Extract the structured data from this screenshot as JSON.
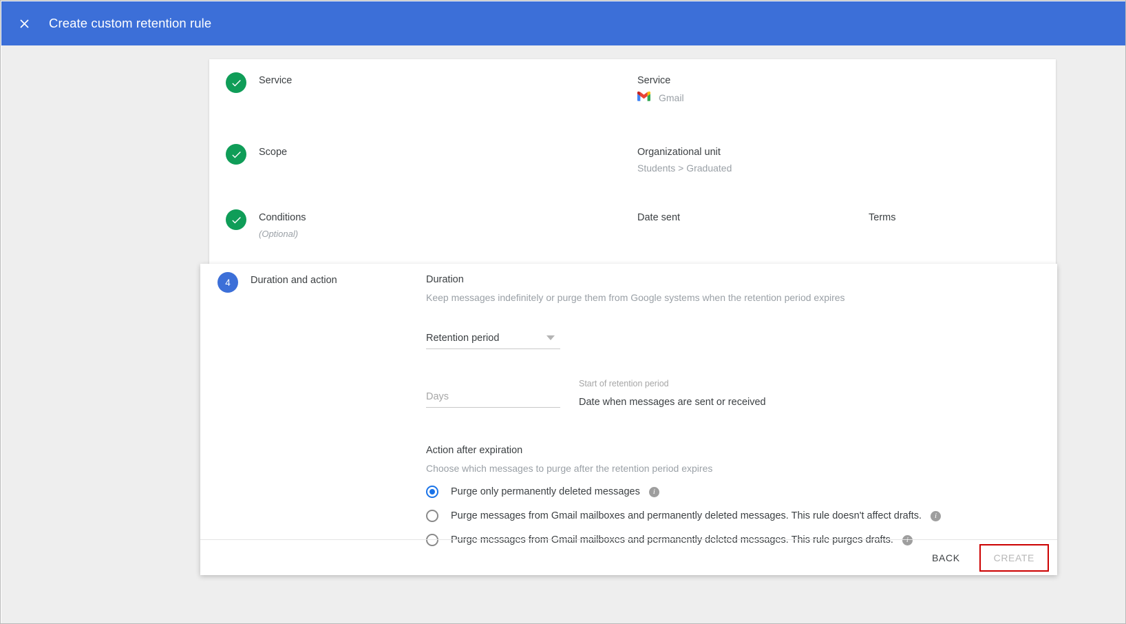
{
  "appbar": {
    "close_icon": "close-icon",
    "title": "Create custom retention rule"
  },
  "summary": {
    "steps": [
      {
        "state_icon": "check-icon",
        "label": "Service",
        "detail_title": "Service",
        "detail_value": "Gmail",
        "detail_icon": "gmail-icon"
      },
      {
        "state_icon": "check-icon",
        "label": "Scope",
        "detail_title": "Organizational unit",
        "detail_value": "Students > Graduated"
      },
      {
        "state_icon": "check-icon",
        "label": "Conditions",
        "optional": "(Optional)",
        "column_a": "Date sent",
        "column_b": "Terms"
      }
    ]
  },
  "step4": {
    "number": "4",
    "label": "Duration and action",
    "duration": {
      "title": "Duration",
      "description": "Keep messages indefinitely or purge them from Google systems when the retention period expires",
      "retention_select_value": "Retention period",
      "days_placeholder": "Days",
      "start_label": "Start of retention period",
      "start_value": "Date when messages are sent or received"
    },
    "action": {
      "title": "Action after expiration",
      "description": "Choose which messages to purge after the retention period expires",
      "options": [
        {
          "label": "Purge only permanently deleted messages",
          "selected": true,
          "info": "i"
        },
        {
          "label": "Purge messages from Gmail mailboxes and permanently deleted messages. This rule doesn't affect drafts.",
          "selected": false,
          "info": "i"
        },
        {
          "label": "Purge messages from Gmail mailboxes and permanently deleted messages. This rule purges drafts.",
          "selected": false,
          "info": "i"
        }
      ]
    },
    "footer": {
      "back_label": "BACK",
      "create_label": "CREATE"
    }
  },
  "colors": {
    "appbar_blue": "#3c6fd8",
    "check_green": "#0f9d58",
    "step_blue": "#3c6fd8",
    "radio_blue": "#1a73e8",
    "highlight_red": "#cc0000"
  }
}
